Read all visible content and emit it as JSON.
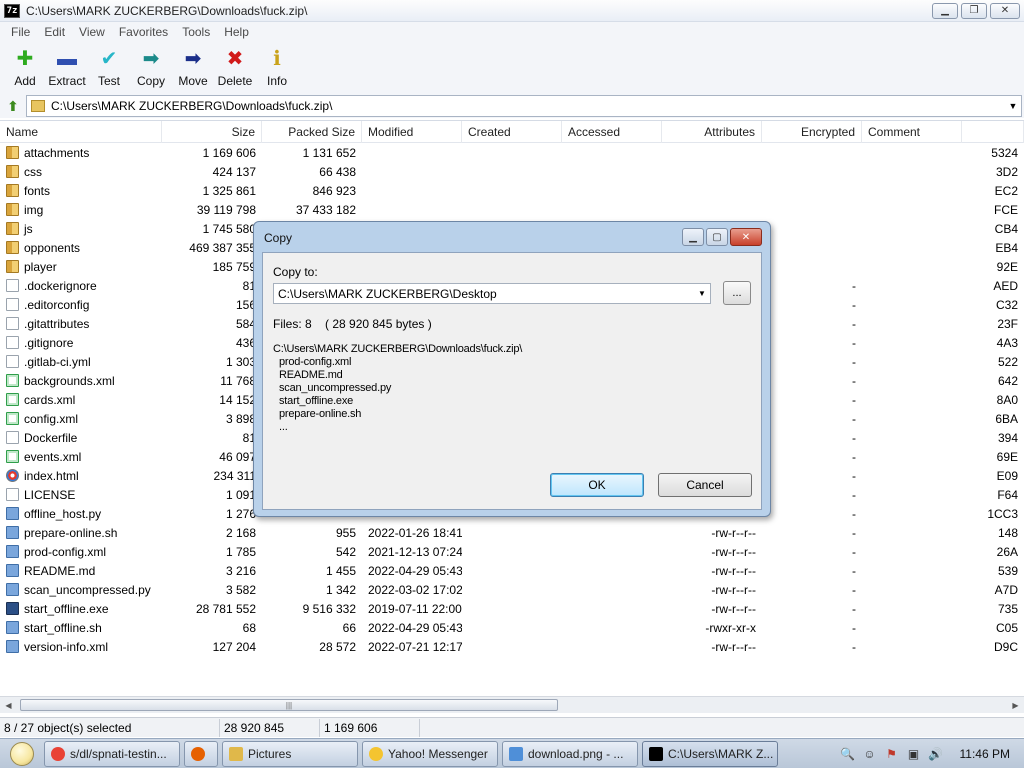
{
  "window": {
    "title": "C:\\Users\\MARK ZUCKERBERG\\Downloads\\fuck.zip\\",
    "app_icon": "7z"
  },
  "menu": [
    "File",
    "Edit",
    "View",
    "Favorites",
    "Tools",
    "Help"
  ],
  "toolbar": [
    {
      "label": "Add",
      "icon": "plus-icon",
      "glyph": "✚",
      "color": "#2eab1f"
    },
    {
      "label": "Extract",
      "icon": "minus-icon",
      "glyph": "▬",
      "color": "#2f4fb0"
    },
    {
      "label": "Test",
      "icon": "checkmark-icon",
      "glyph": "✔",
      "color": "#27b6c8"
    },
    {
      "label": "Copy",
      "icon": "copy-arrow-icon",
      "glyph": "➡",
      "color": "#1b8a8a"
    },
    {
      "label": "Move",
      "icon": "move-arrow-icon",
      "glyph": "➡",
      "color": "#1b2f8a"
    },
    {
      "label": "Delete",
      "icon": "delete-x-icon",
      "glyph": "✖",
      "color": "#d11a1a"
    },
    {
      "label": "Info",
      "icon": "info-icon",
      "glyph": "ℹ",
      "color": "#c9a21a"
    }
  ],
  "address": {
    "path": "C:\\Users\\MARK ZUCKERBERG\\Downloads\\fuck.zip\\"
  },
  "columns": {
    "name": "Name",
    "size": "Size",
    "packed": "Packed Size",
    "modified": "Modified",
    "created": "Created",
    "accessed": "Accessed",
    "attributes": "Attributes",
    "encrypted": "Encrypted",
    "comment": "Comment"
  },
  "files": [
    {
      "name": "attachments",
      "type": "folder",
      "size": "1 169 606",
      "packed": "1 131 652",
      "modified": "",
      "attributes": "",
      "encrypted": "",
      "crc": "5324"
    },
    {
      "name": "css",
      "type": "folder",
      "size": "424 137",
      "packed": "66 438",
      "modified": "",
      "attributes": "",
      "encrypted": "",
      "crc": "3D2"
    },
    {
      "name": "fonts",
      "type": "folder",
      "size": "1 325 861",
      "packed": "846 923",
      "modified": "",
      "attributes": "",
      "encrypted": "",
      "crc": "EC2"
    },
    {
      "name": "img",
      "type": "folder",
      "size": "39 119 798",
      "packed": "37 433 182",
      "modified": "",
      "attributes": "",
      "encrypted": "",
      "crc": "FCE"
    },
    {
      "name": "js",
      "type": "folder",
      "size": "1 745 580",
      "packed": "",
      "modified": "",
      "attributes": "",
      "encrypted": "",
      "crc": "CB4"
    },
    {
      "name": "opponents",
      "type": "folder",
      "size": "469 387 355",
      "packed": "",
      "modified": "",
      "attributes": "",
      "encrypted": "",
      "crc": "EB4"
    },
    {
      "name": "player",
      "type": "folder",
      "size": "185 759",
      "packed": "",
      "modified": "",
      "attributes": "",
      "encrypted": "",
      "crc": "92E"
    },
    {
      "name": ".dockerignore",
      "type": "file",
      "size": "81",
      "packed": "",
      "modified": "",
      "attributes": "",
      "encrypted": "-",
      "crc": "AED"
    },
    {
      "name": ".editorconfig",
      "type": "file",
      "size": "156",
      "packed": "",
      "modified": "",
      "attributes": "",
      "encrypted": "-",
      "crc": "C32"
    },
    {
      "name": ".gitattributes",
      "type": "file",
      "size": "584",
      "packed": "",
      "modified": "",
      "attributes": "",
      "encrypted": "-",
      "crc": "23F"
    },
    {
      "name": ".gitignore",
      "type": "file",
      "size": "436",
      "packed": "",
      "modified": "",
      "attributes": "",
      "encrypted": "-",
      "crc": "4A3"
    },
    {
      "name": ".gitlab-ci.yml",
      "type": "file",
      "size": "1 303",
      "packed": "",
      "modified": "",
      "attributes": "",
      "encrypted": "-",
      "crc": "522"
    },
    {
      "name": "backgrounds.xml",
      "type": "xml",
      "size": "11 768",
      "packed": "",
      "modified": "",
      "attributes": "",
      "encrypted": "-",
      "crc": "642"
    },
    {
      "name": "cards.xml",
      "type": "xml",
      "size": "14 152",
      "packed": "",
      "modified": "",
      "attributes": "",
      "encrypted": "-",
      "crc": "8A0"
    },
    {
      "name": "config.xml",
      "type": "xml",
      "size": "3 898",
      "packed": "",
      "modified": "",
      "attributes": "",
      "encrypted": "-",
      "crc": "6BA"
    },
    {
      "name": "Dockerfile",
      "type": "file",
      "size": "81",
      "packed": "",
      "modified": "",
      "attributes": "",
      "encrypted": "-",
      "crc": "394"
    },
    {
      "name": "events.xml",
      "type": "xml",
      "size": "46 097",
      "packed": "",
      "modified": "",
      "attributes": "",
      "encrypted": "-",
      "crc": "69E"
    },
    {
      "name": "index.html",
      "type": "html",
      "size": "234 311",
      "packed": "",
      "modified": "",
      "attributes": "",
      "encrypted": "-",
      "crc": "E09"
    },
    {
      "name": "LICENSE",
      "type": "file",
      "size": "1 091",
      "packed": "",
      "modified": "",
      "attributes": "",
      "encrypted": "-",
      "crc": "F64"
    },
    {
      "name": "offline_host.py",
      "type": "script",
      "size": "1 276",
      "packed": "",
      "modified": "",
      "attributes": "",
      "encrypted": "-",
      "crc": "1CC3"
    },
    {
      "name": "prepare-online.sh",
      "type": "script",
      "size": "2 168",
      "packed": "955",
      "modified": "2022-01-26 18:41",
      "attributes": "-rw-r--r--",
      "encrypted": "-",
      "crc": "148"
    },
    {
      "name": "prod-config.xml",
      "type": "script",
      "size": "1 785",
      "packed": "542",
      "modified": "2021-12-13 07:24",
      "attributes": "-rw-r--r--",
      "encrypted": "-",
      "crc": "26A"
    },
    {
      "name": "README.md",
      "type": "script",
      "size": "3 216",
      "packed": "1 455",
      "modified": "2022-04-29 05:43",
      "attributes": "-rw-r--r--",
      "encrypted": "-",
      "crc": "539"
    },
    {
      "name": "scan_uncompressed.py",
      "type": "script",
      "size": "3 582",
      "packed": "1 342",
      "modified": "2022-03-02 17:02",
      "attributes": "-rw-r--r--",
      "encrypted": "-",
      "crc": "A7D"
    },
    {
      "name": "start_offline.exe",
      "type": "exe",
      "size": "28 781 552",
      "packed": "9 516 332",
      "modified": "2019-07-11 22:00",
      "attributes": "-rw-r--r--",
      "encrypted": "-",
      "crc": "735"
    },
    {
      "name": "start_offline.sh",
      "type": "script",
      "size": "68",
      "packed": "66",
      "modified": "2022-04-29 05:43",
      "attributes": "-rwxr-xr-x",
      "encrypted": "-",
      "crc": "C05"
    },
    {
      "name": "version-info.xml",
      "type": "script",
      "size": "127 204",
      "packed": "28 572",
      "modified": "2022-07-21 12:17",
      "attributes": "-rw-r--r--",
      "encrypted": "-",
      "crc": "D9C"
    }
  ],
  "status": {
    "selected": "8 / 27 object(s) selected",
    "size": "28 920 845",
    "packed": "1 169 606"
  },
  "dialog": {
    "title": "Copy",
    "copy_to_label": "Copy to:",
    "copy_to_value": "C:\\Users\\MARK ZUCKERBERG\\Desktop",
    "browse_label": "...",
    "files_info": "Files: 8    ( 28 920 845 bytes )",
    "source_path": "C:\\Users\\MARK ZUCKERBERG\\Downloads\\fuck.zip\\",
    "file_list": [
      "prod-config.xml",
      "README.md",
      "scan_uncompressed.py",
      "start_offline.exe",
      "prepare-online.sh",
      "..."
    ],
    "ok_label": "OK",
    "cancel_label": "Cancel"
  },
  "taskbar": {
    "tasks": [
      {
        "label": "s/dl/spnati-testin...",
        "icon": "chrome-icon",
        "color": "#e94235",
        "width": 136
      },
      {
        "label": "",
        "icon": "firefox-icon",
        "color": "#e66000",
        "width": 34
      },
      {
        "label": "Pictures",
        "icon": "folder-icon",
        "color": "#e0b84a",
        "width": 136
      },
      {
        "label": "Yahoo! Messenger",
        "icon": "yahoo-messenger-icon",
        "color": "#f4c430",
        "width": 136
      },
      {
        "label": "download.png - ...",
        "icon": "paint-icon",
        "color": "#4f8fd8",
        "width": 136
      },
      {
        "label": "C:\\Users\\MARK Z...",
        "icon": "7zip-icon",
        "color": "#000000",
        "width": 136,
        "active": true
      }
    ],
    "clock": "11:46 PM"
  }
}
